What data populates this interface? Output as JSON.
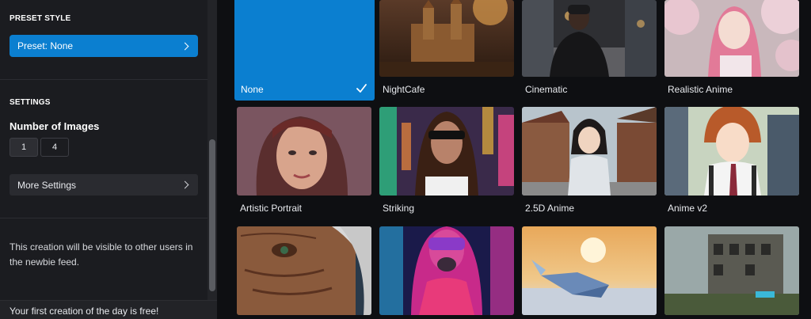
{
  "sidebar": {
    "preset_section_title": "PRESET STYLE",
    "preset_button_label": "Preset: None",
    "settings_section_title": "SETTINGS",
    "number_of_images_label": "Number of Images",
    "number_options": [
      "1",
      "4"
    ],
    "selected_number": "1",
    "more_settings_label": "More Settings",
    "visibility_note": "This creation will be visible to other users in the newbie feed.",
    "footer_note": "Your first creation of the day is free!"
  },
  "presets": [
    {
      "label": "None",
      "selected": true
    },
    {
      "label": "NightCafe"
    },
    {
      "label": "Cinematic"
    },
    {
      "label": "Realistic Anime"
    },
    {
      "label": "Artistic Portrait"
    },
    {
      "label": "Striking"
    },
    {
      "label": "2.5D Anime"
    },
    {
      "label": "Anime v2"
    },
    {
      "label": ""
    },
    {
      "label": ""
    },
    {
      "label": ""
    },
    {
      "label": ""
    }
  ],
  "colors": {
    "accent": "#0b7fd0",
    "sidebar_bg": "#1b1c20",
    "page_bg": "#0e0f12"
  }
}
